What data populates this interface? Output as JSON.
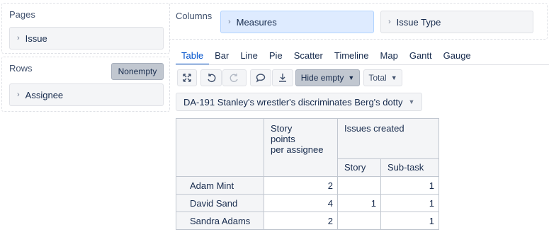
{
  "pages": {
    "title": "Pages",
    "items": [
      {
        "label": "Issue"
      }
    ]
  },
  "rows": {
    "title": "Rows",
    "nonempty_label": "Nonempty",
    "items": [
      {
        "label": "Assignee"
      }
    ]
  },
  "columns": {
    "title": "Columns",
    "items": [
      {
        "label": "Measures",
        "selected": true
      },
      {
        "label": "Issue Type",
        "selected": false
      }
    ]
  },
  "tabs": [
    "Table",
    "Bar",
    "Line",
    "Pie",
    "Scatter",
    "Timeline",
    "Map",
    "Gantt",
    "Gauge"
  ],
  "active_tab": "Table",
  "toolbar": {
    "icons": [
      "expand-icon",
      "undo-icon",
      "redo-icon",
      "comment-icon",
      "download-icon"
    ],
    "hide_empty_label": "Hide empty",
    "total_label": "Total"
  },
  "filter": {
    "label": "DA-191 Stanley's wrestler's discriminates Berg's dotty"
  },
  "table": {
    "measure_header": "Story\npoints\nper assignee",
    "group_header": "Issues created",
    "sub_headers": [
      "Story",
      "Sub-task"
    ],
    "rows": [
      {
        "name": "Adam Mint",
        "story_points": "2",
        "story": "",
        "subtask": "1"
      },
      {
        "name": "David Sand",
        "story_points": "4",
        "story": "1",
        "subtask": "1"
      },
      {
        "name": "Sandra Adams",
        "story_points": "2",
        "story": "",
        "subtask": "1"
      }
    ]
  },
  "colors": {
    "accent": "#0052cc",
    "selected_bg": "#deebff",
    "chip_bg": "#f4f5f7",
    "dark_btn": "#c1c7d0"
  }
}
